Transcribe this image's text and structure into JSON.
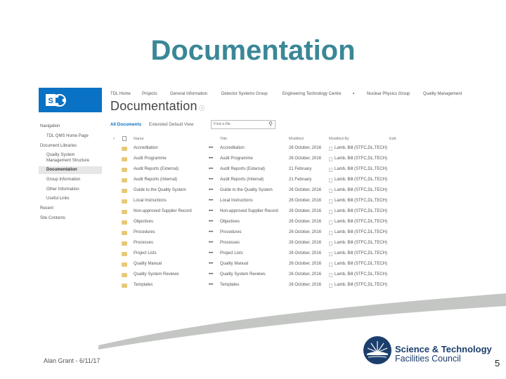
{
  "slide": {
    "title": "Documentation",
    "footer": "Alan Grant - 6/11/17",
    "page_number": "5",
    "logo": {
      "line1": "Science & Technology",
      "line2": "Facilities Council"
    }
  },
  "sharepoint": {
    "top_nav": [
      "TDL Home",
      "Projects",
      "General Information",
      "Detector Systems Group",
      "Engineering Technology Centre",
      "Nuclear Physics Group",
      "Quality Management"
    ],
    "library_title": "Documentation",
    "left_nav": {
      "heading": "Navigation",
      "items": [
        {
          "label": "TDL QMS Home Page",
          "indent": true
        },
        {
          "label": "Document Libraries",
          "indent": false
        },
        {
          "label": "Quality System",
          "label2": "Management Structure",
          "indent": true
        },
        {
          "label": "Documentation",
          "indent": true,
          "active": true
        },
        {
          "label": "Group Information",
          "indent": true
        },
        {
          "label": "Other Information",
          "indent": true
        },
        {
          "label": "Useful Links",
          "indent": true
        },
        {
          "label": "Recent",
          "indent": false
        },
        {
          "label": "Site Contents",
          "indent": false
        }
      ]
    },
    "views": {
      "active": "All Documents",
      "other": "Extended Default View"
    },
    "search": {
      "placeholder": "Find a file"
    },
    "columns": {
      "check": "✓",
      "name": "Name",
      "title": "Title",
      "modified": "Modified",
      "modified_by": "Modified By",
      "edit": "Edit"
    },
    "rows": [
      {
        "name": "Accreditation",
        "title": "Accreditation",
        "modified": "26 October, 2016",
        "modified_by": "Lamb, Bill (STFC,DL,TECH)"
      },
      {
        "name": "Audit Programme",
        "title": "Audit Programme",
        "modified": "26 October, 2016",
        "modified_by": "Lamb, Bill (STFC,DL,TECH)"
      },
      {
        "name": "Audit Reports (External)",
        "title": "Audit Reports (External)",
        "modified": "21 February",
        "modified_by": "Lamb, Bill (STFC,DL,TECH)"
      },
      {
        "name": "Audit Reports (Internal)",
        "title": "Audit Reports (Internal)",
        "modified": "21 February",
        "modified_by": "Lamb, Bill (STFC,DL,TECH)"
      },
      {
        "name": "Guide to the Quality System",
        "title": "Guide to the Quality System",
        "modified": "26 October, 2016",
        "modified_by": "Lamb, Bill (STFC,DL,TECH)"
      },
      {
        "name": "Local Instructions",
        "title": "Local Instructions",
        "modified": "26 October, 2016",
        "modified_by": "Lamb, Bill (STFC,DL,TECH)"
      },
      {
        "name": "Non-approved Supplier Record",
        "title": "Non-approved Supplier Record",
        "modified": "26 October, 2016",
        "modified_by": "Lamb, Bill (STFC,DL,TECH)"
      },
      {
        "name": "Objectives",
        "title": "Objectives",
        "modified": "26 October, 2016",
        "modified_by": "Lamb, Bill (STFC,DL,TECH)"
      },
      {
        "name": "Procedures",
        "title": "Procedures",
        "modified": "26 October, 2016",
        "modified_by": "Lamb, Bill (STFC,DL,TECH)"
      },
      {
        "name": "Processes",
        "title": "Processes",
        "modified": "26 October, 2016",
        "modified_by": "Lamb, Bill (STFC,DL,TECH)"
      },
      {
        "name": "Project Lists",
        "title": "Project Lists",
        "modified": "26 October, 2016",
        "modified_by": "Lamb, Bill (STFC,DL,TECH)"
      },
      {
        "name": "Quality Manual",
        "title": "Quality Manual",
        "modified": "26 October, 2016",
        "modified_by": "Lamb, Bill (STFC,DL,TECH)"
      },
      {
        "name": "Quality System Reviews",
        "title": "Quality System Reviews",
        "modified": "26 October, 2016",
        "modified_by": "Lamb, Bill (STFC,DL,TECH)"
      },
      {
        "name": "Templates",
        "title": "Templates",
        "modified": "26 October, 2016",
        "modified_by": "Lamb, Bill (STFC,DL,TECH)"
      }
    ],
    "ellipsis": "•••"
  }
}
